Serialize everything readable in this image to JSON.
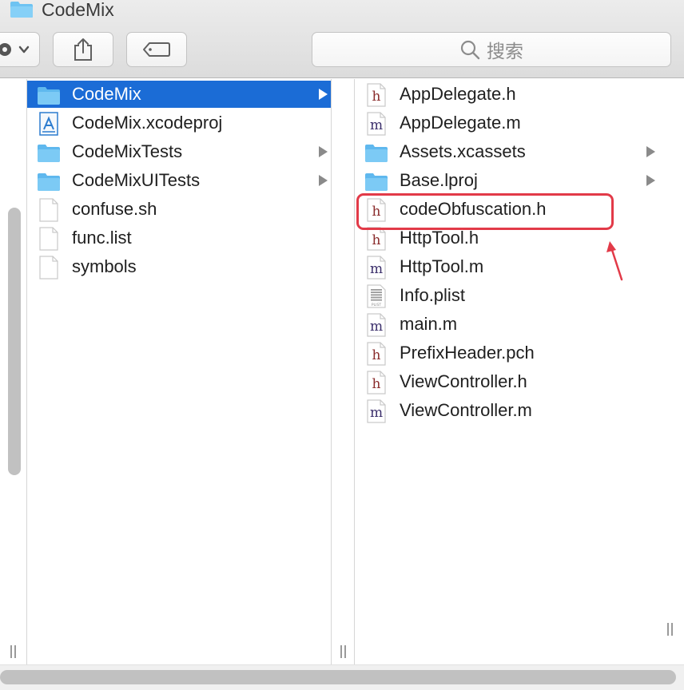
{
  "window": {
    "title": "CodeMix"
  },
  "toolbar": {
    "search_placeholder": "搜索"
  },
  "left_column": {
    "items": [
      {
        "label": "CodeMix",
        "type": "folder",
        "selected": true,
        "has_children": true
      },
      {
        "label": "CodeMix.xcodeproj",
        "type": "xcodeproj"
      },
      {
        "label": "CodeMixTests",
        "type": "folder",
        "has_children": true
      },
      {
        "label": "CodeMixUITests",
        "type": "folder",
        "has_children": true
      },
      {
        "label": "confuse.sh",
        "type": "file"
      },
      {
        "label": "func.list",
        "type": "file"
      },
      {
        "label": "symbols",
        "type": "file"
      }
    ]
  },
  "right_column": {
    "items": [
      {
        "label": "AppDelegate.h",
        "type": "h"
      },
      {
        "label": "AppDelegate.m",
        "type": "m"
      },
      {
        "label": "Assets.xcassets",
        "type": "folder",
        "has_children": true
      },
      {
        "label": "Base.lproj",
        "type": "folder",
        "has_children": true
      },
      {
        "label": "codeObfuscation.h",
        "type": "h",
        "highlighted": true
      },
      {
        "label": "HttpTool.h",
        "type": "h"
      },
      {
        "label": "HttpTool.m",
        "type": "m"
      },
      {
        "label": "Info.plist",
        "type": "plist"
      },
      {
        "label": "main.m",
        "type": "m"
      },
      {
        "label": "PrefixHeader.pch",
        "type": "h"
      },
      {
        "label": "ViewController.h",
        "type": "h"
      },
      {
        "label": "ViewController.m",
        "type": "m"
      }
    ]
  },
  "icons": {
    "h_letter": "h",
    "m_letter": "m",
    "plist_letter": "PLIST"
  },
  "colors": {
    "selection": "#1b6cd6",
    "annotation": "#e23a48",
    "folder": "#6ec3f2"
  }
}
